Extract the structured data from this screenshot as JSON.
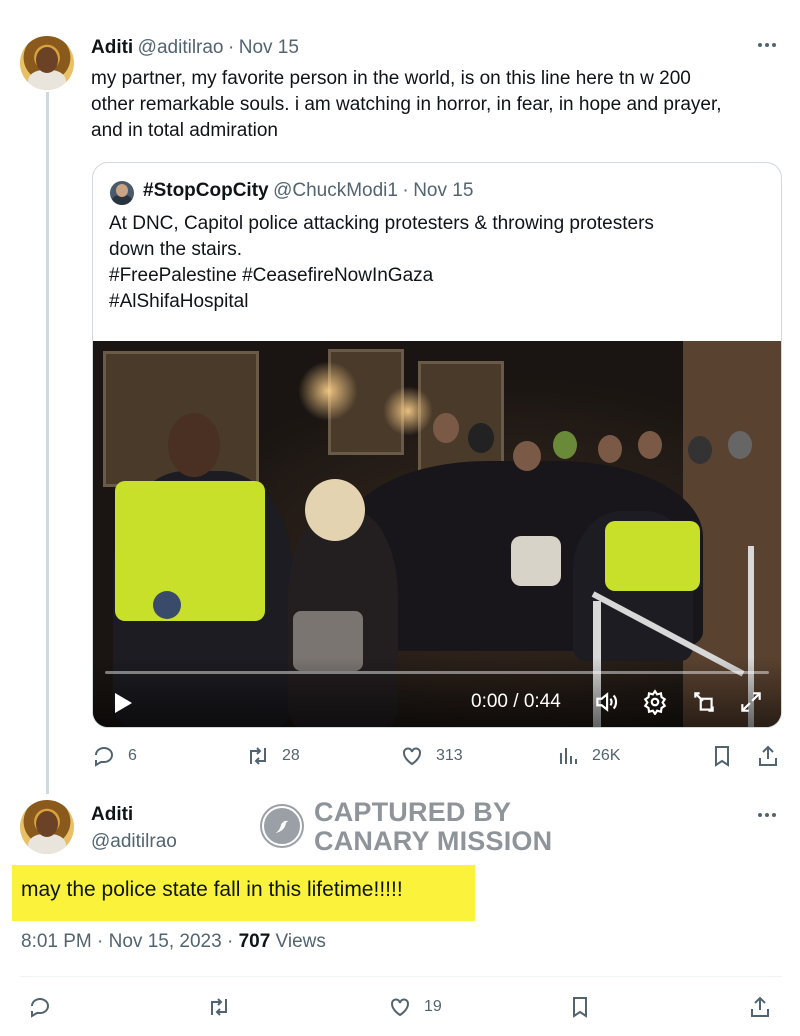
{
  "first_tweet": {
    "name": "Aditi",
    "handle": "@aditilrao",
    "separator": "·",
    "date": "Nov 15",
    "more_icon": "ellipsis-icon",
    "text_lines": [
      "my partner, my favorite person in the world, is on this line here tn w 200",
      "other remarkable souls. i am watching in horror, in fear, in hope and prayer,",
      "and in total admiration"
    ]
  },
  "quoted_tweet": {
    "name": "#StopCopCity",
    "handle": "@ChuckModi1",
    "separator": "·",
    "date": "Nov 15",
    "text_lines": [
      "At DNC, Capitol police attacking protesters & throwing protesters",
      "down the stairs.",
      "#FreePalestine #CeasefireNowInGaza",
      "#AlShifaHospital"
    ],
    "video": {
      "time": "0:00 / 0:44",
      "progress": 0,
      "icons": [
        "play-icon",
        "volume-icon",
        "settings-icon",
        "picture-in-picture-icon",
        "fullscreen-icon"
      ]
    }
  },
  "first_tweet_actions": {
    "replies": "6",
    "reposts": "28",
    "likes": "313",
    "views": "26K",
    "icons": [
      "reply-icon",
      "repost-icon",
      "like-icon",
      "views-icon",
      "bookmark-icon",
      "share-icon"
    ]
  },
  "second_tweet": {
    "name": "Aditi",
    "handle": "@aditilrao",
    "more_icon": "ellipsis-icon",
    "text": "may the police state fall in this lifetime!!!!!",
    "time": "8:01 PM · Nov 15, 2023 · ",
    "views_count": "707",
    "views_label": " Views"
  },
  "watermark": {
    "line1": "CAPTURED BY",
    "line2": "CANARY MISSION"
  },
  "second_tweet_actions": {
    "likes": "19",
    "icons": [
      "reply-icon",
      "repost-icon",
      "like-icon",
      "bookmark-icon",
      "share-icon"
    ]
  },
  "colors": {
    "highlight": "#fbf23c",
    "muted": "#536471",
    "text": "#0f1419"
  }
}
